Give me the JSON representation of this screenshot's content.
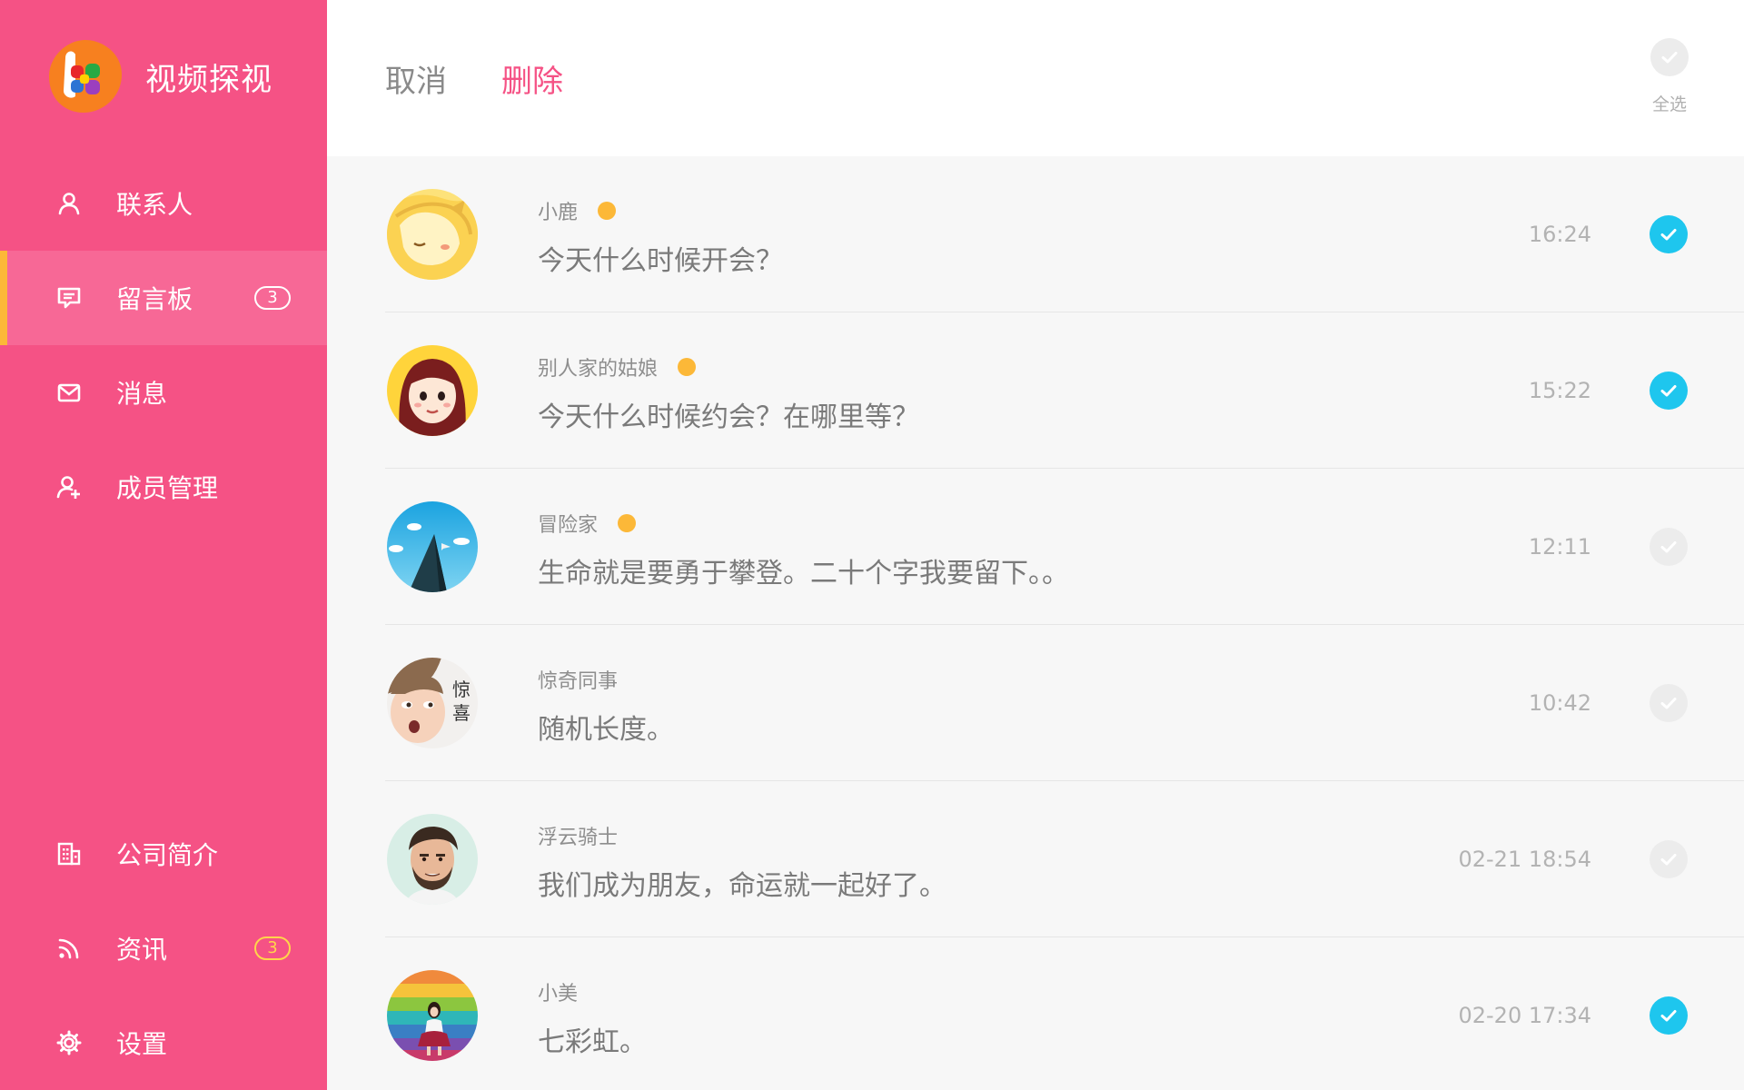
{
  "app": {
    "title": "视频探视"
  },
  "sidebar": {
    "items": [
      {
        "label": "联系人",
        "icon": "user-icon",
        "active": false,
        "badge": ""
      },
      {
        "label": "留言板",
        "icon": "message-board-icon",
        "active": true,
        "badge": "3"
      },
      {
        "label": "消息",
        "icon": "mail-icon",
        "active": false,
        "badge": ""
      },
      {
        "label": "成员管理",
        "icon": "user-add-icon",
        "active": false,
        "badge": ""
      }
    ],
    "bottom_items": [
      {
        "label": "公司简介",
        "icon": "building-icon",
        "badge": ""
      },
      {
        "label": "资讯",
        "icon": "rss-icon",
        "badge": "3"
      },
      {
        "label": "设置",
        "icon": "gear-icon",
        "badge": ""
      }
    ]
  },
  "header": {
    "cancel_label": "取消",
    "delete_label": "删除",
    "select_all_label": "全选"
  },
  "messages": [
    {
      "name": "小鹿",
      "text": "今天什么时候开会？",
      "time": "16:24",
      "unread": true,
      "checked": true,
      "avatar": "cartoon-fox-avatar"
    },
    {
      "name": "别人家的姑娘",
      "text": "今天什么时候约会？在哪里等？",
      "time": "15:22",
      "unread": true,
      "checked": true,
      "avatar": "cartoon-girl-avatar"
    },
    {
      "name": "冒险家",
      "text": "生命就是要勇于攀登。二十个字我要留下。。",
      "time": "12:11",
      "unread": true,
      "checked": false,
      "avatar": "mountain-avatar"
    },
    {
      "name": "惊奇同事",
      "text": "随机长度。",
      "time": "10:42",
      "unread": false,
      "checked": false,
      "avatar": "surprised-boy-avatar"
    },
    {
      "name": "浮云骑士",
      "text": "我们成为朋友，命运就一起好了。",
      "time": "02-21 18:54",
      "unread": false,
      "checked": false,
      "avatar": "bearded-man-avatar"
    },
    {
      "name": "小美",
      "text": "七彩虹。",
      "time": "02-20 17:34",
      "unread": false,
      "checked": true,
      "avatar": "rainbow-girl-avatar"
    }
  ],
  "colors": {
    "sidebar_bg": "#f55285",
    "active_item_bg": "#f76896",
    "active_indicator": "#fcb838",
    "accent_pink": "#f55285",
    "check_blue": "#1ec6ee",
    "unread_dot": "#fcb838",
    "badge_yellow": "#ffd54a"
  }
}
